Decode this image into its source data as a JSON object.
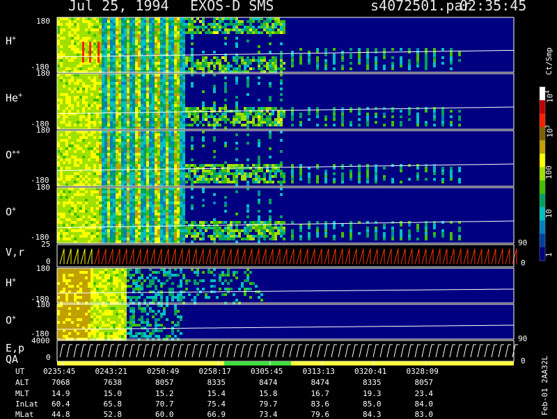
{
  "header": {
    "date": "Jul 25, 1994",
    "instrument": "EXOS-D SMS",
    "file": "s4072501.par",
    "time": "02:35:45"
  },
  "panels": [
    {
      "id": "h-plus-1",
      "label": "H",
      "sup": "+",
      "ytop": "180",
      "ybot": "-180"
    },
    {
      "id": "he-plus",
      "label": "He",
      "sup": "+",
      "ytop": "180",
      "ybot": "-180"
    },
    {
      "id": "o-plus-plus",
      "label": "O",
      "sup": "++",
      "ytop": "180",
      "ybot": "-180"
    },
    {
      "id": "o-plus-1",
      "label": "O",
      "sup": "+",
      "ytop": "180",
      "ybot": "-180"
    },
    {
      "id": "vr",
      "label": "V,r",
      "sup": "",
      "ytop": "25",
      "ybot": "0",
      "rtop": "90",
      "rbot": "0"
    },
    {
      "id": "h-plus-2",
      "label": "H",
      "sup": "+",
      "ytop": "180",
      "ybot": "-180"
    },
    {
      "id": "o-plus-2",
      "label": "O",
      "sup": "+",
      "ytop": "180",
      "ybot": "-180",
      "rbot": "90"
    },
    {
      "id": "ep",
      "label": "E,p",
      "sup": "",
      "ytop": "4000",
      "ybot": "0",
      "rbot": "0"
    }
  ],
  "qa_label": "QA",
  "colorbar": {
    "unit": "Ct/Smp",
    "labels": [
      {
        "base": "10",
        "exp": "4"
      },
      {
        "base": "10",
        "exp": "3"
      },
      {
        "base": "100",
        "exp": ""
      },
      {
        "base": "10",
        "exp": ""
      },
      {
        "base": "1",
        "exp": ""
      }
    ],
    "colors": [
      "#ffffff",
      "#c00000",
      "#ff2000",
      "#806000",
      "#c0a000",
      "#ffff00",
      "#a0e000",
      "#40c000",
      "#00a060",
      "#00c0c0",
      "#0080c0",
      "#0040a0",
      "#000080"
    ]
  },
  "footer_id": "Feb-01 2AA32L",
  "chart_data": {
    "type": "heatmap",
    "x_ticks": [
      "0235:45",
      "0243:21",
      "0250:49",
      "0258:17",
      "0305:45",
      "0313:13",
      "0320:41",
      "0328:09"
    ],
    "rows": [
      {
        "name": "UT",
        "values": [
          "0235:45",
          "0243:21",
          "0250:49",
          "0258:17",
          "0305:45",
          "0313:13",
          "0320:41",
          "0328:09"
        ]
      },
      {
        "name": "ALT",
        "values": [
          "7068",
          "7638",
          "8057",
          "8335",
          "8474",
          "8474",
          "8335",
          "8057"
        ]
      },
      {
        "name": "MLT",
        "values": [
          "14.9",
          "15.0",
          "15.2",
          "15.4",
          "15.8",
          "16.7",
          "19.3",
          "23.4"
        ]
      },
      {
        "name": "InLat",
        "values": [
          "60.4",
          "65.8",
          "70.7",
          "75.4",
          "79.7",
          "83.6",
          "85.0",
          "84.0"
        ]
      },
      {
        "name": "MLat",
        "values": [
          "44.8",
          "52.8",
          "60.0",
          "66.9",
          "73.4",
          "79.6",
          "84.3",
          "83.0"
        ]
      }
    ],
    "y_range_angle": [
      -180,
      180
    ],
    "y_range_vr": [
      0,
      25
    ],
    "y_range_ep": [
      0,
      4000
    ],
    "colorbar_range": [
      1,
      10000
    ],
    "log_color_scale": true
  }
}
